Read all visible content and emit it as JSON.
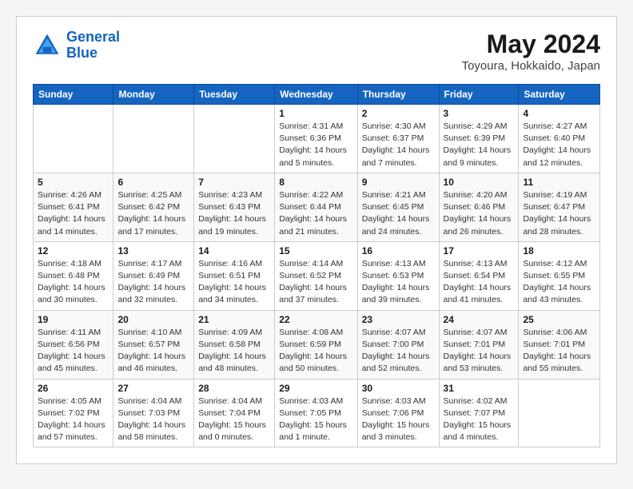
{
  "header": {
    "logo_line1": "General",
    "logo_line2": "Blue",
    "title": "May 2024",
    "subtitle": "Toyoura, Hokkaido, Japan"
  },
  "weekdays": [
    "Sunday",
    "Monday",
    "Tuesday",
    "Wednesday",
    "Thursday",
    "Friday",
    "Saturday"
  ],
  "weeks": [
    [
      {
        "day": "",
        "info": ""
      },
      {
        "day": "",
        "info": ""
      },
      {
        "day": "",
        "info": ""
      },
      {
        "day": "1",
        "info": "Sunrise: 4:31 AM\nSunset: 6:36 PM\nDaylight: 14 hours\nand 5 minutes."
      },
      {
        "day": "2",
        "info": "Sunrise: 4:30 AM\nSunset: 6:37 PM\nDaylight: 14 hours\nand 7 minutes."
      },
      {
        "day": "3",
        "info": "Sunrise: 4:29 AM\nSunset: 6:39 PM\nDaylight: 14 hours\nand 9 minutes."
      },
      {
        "day": "4",
        "info": "Sunrise: 4:27 AM\nSunset: 6:40 PM\nDaylight: 14 hours\nand 12 minutes."
      }
    ],
    [
      {
        "day": "5",
        "info": "Sunrise: 4:26 AM\nSunset: 6:41 PM\nDaylight: 14 hours\nand 14 minutes."
      },
      {
        "day": "6",
        "info": "Sunrise: 4:25 AM\nSunset: 6:42 PM\nDaylight: 14 hours\nand 17 minutes."
      },
      {
        "day": "7",
        "info": "Sunrise: 4:23 AM\nSunset: 6:43 PM\nDaylight: 14 hours\nand 19 minutes."
      },
      {
        "day": "8",
        "info": "Sunrise: 4:22 AM\nSunset: 6:44 PM\nDaylight: 14 hours\nand 21 minutes."
      },
      {
        "day": "9",
        "info": "Sunrise: 4:21 AM\nSunset: 6:45 PM\nDaylight: 14 hours\nand 24 minutes."
      },
      {
        "day": "10",
        "info": "Sunrise: 4:20 AM\nSunset: 6:46 PM\nDaylight: 14 hours\nand 26 minutes."
      },
      {
        "day": "11",
        "info": "Sunrise: 4:19 AM\nSunset: 6:47 PM\nDaylight: 14 hours\nand 28 minutes."
      }
    ],
    [
      {
        "day": "12",
        "info": "Sunrise: 4:18 AM\nSunset: 6:48 PM\nDaylight: 14 hours\nand 30 minutes."
      },
      {
        "day": "13",
        "info": "Sunrise: 4:17 AM\nSunset: 6:49 PM\nDaylight: 14 hours\nand 32 minutes."
      },
      {
        "day": "14",
        "info": "Sunrise: 4:16 AM\nSunset: 6:51 PM\nDaylight: 14 hours\nand 34 minutes."
      },
      {
        "day": "15",
        "info": "Sunrise: 4:14 AM\nSunset: 6:52 PM\nDaylight: 14 hours\nand 37 minutes."
      },
      {
        "day": "16",
        "info": "Sunrise: 4:13 AM\nSunset: 6:53 PM\nDaylight: 14 hours\nand 39 minutes."
      },
      {
        "day": "17",
        "info": "Sunrise: 4:13 AM\nSunset: 6:54 PM\nDaylight: 14 hours\nand 41 minutes."
      },
      {
        "day": "18",
        "info": "Sunrise: 4:12 AM\nSunset: 6:55 PM\nDaylight: 14 hours\nand 43 minutes."
      }
    ],
    [
      {
        "day": "19",
        "info": "Sunrise: 4:11 AM\nSunset: 6:56 PM\nDaylight: 14 hours\nand 45 minutes."
      },
      {
        "day": "20",
        "info": "Sunrise: 4:10 AM\nSunset: 6:57 PM\nDaylight: 14 hours\nand 46 minutes."
      },
      {
        "day": "21",
        "info": "Sunrise: 4:09 AM\nSunset: 6:58 PM\nDaylight: 14 hours\nand 48 minutes."
      },
      {
        "day": "22",
        "info": "Sunrise: 4:08 AM\nSunset: 6:59 PM\nDaylight: 14 hours\nand 50 minutes."
      },
      {
        "day": "23",
        "info": "Sunrise: 4:07 AM\nSunset: 7:00 PM\nDaylight: 14 hours\nand 52 minutes."
      },
      {
        "day": "24",
        "info": "Sunrise: 4:07 AM\nSunset: 7:01 PM\nDaylight: 14 hours\nand 53 minutes."
      },
      {
        "day": "25",
        "info": "Sunrise: 4:06 AM\nSunset: 7:01 PM\nDaylight: 14 hours\nand 55 minutes."
      }
    ],
    [
      {
        "day": "26",
        "info": "Sunrise: 4:05 AM\nSunset: 7:02 PM\nDaylight: 14 hours\nand 57 minutes."
      },
      {
        "day": "27",
        "info": "Sunrise: 4:04 AM\nSunset: 7:03 PM\nDaylight: 14 hours\nand 58 minutes."
      },
      {
        "day": "28",
        "info": "Sunrise: 4:04 AM\nSunset: 7:04 PM\nDaylight: 15 hours\nand 0 minutes."
      },
      {
        "day": "29",
        "info": "Sunrise: 4:03 AM\nSunset: 7:05 PM\nDaylight: 15 hours\nand 1 minute."
      },
      {
        "day": "30",
        "info": "Sunrise: 4:03 AM\nSunset: 7:06 PM\nDaylight: 15 hours\nand 3 minutes."
      },
      {
        "day": "31",
        "info": "Sunrise: 4:02 AM\nSunset: 7:07 PM\nDaylight: 15 hours\nand 4 minutes."
      },
      {
        "day": "",
        "info": ""
      }
    ]
  ]
}
